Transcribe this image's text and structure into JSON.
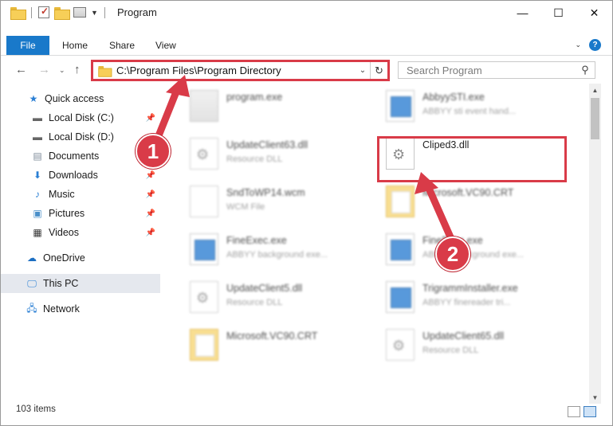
{
  "window": {
    "title": "Program",
    "controls": {
      "minimize": "—",
      "maximize": "☐",
      "close": "✕"
    }
  },
  "ribbon": {
    "file": "File",
    "tabs": [
      "Home",
      "Share",
      "View"
    ]
  },
  "address": {
    "path": "C:\\Program Files\\Program Directory",
    "search_placeholder": "Search Program"
  },
  "nav": {
    "quick_access": "Quick access",
    "items": [
      {
        "label": "Local Disk (C:)",
        "icon": "drive-icon",
        "pinned": true
      },
      {
        "label": "Local Disk (D:)",
        "icon": "drive-icon",
        "pinned": false
      },
      {
        "label": "Documents",
        "icon": "documents-icon",
        "pinned": true
      },
      {
        "label": "Downloads",
        "icon": "downloads-icon",
        "pinned": true
      },
      {
        "label": "Music",
        "icon": "music-icon",
        "pinned": true
      },
      {
        "label": "Pictures",
        "icon": "pictures-icon",
        "pinned": true
      },
      {
        "label": "Videos",
        "icon": "videos-icon",
        "pinned": true
      }
    ],
    "onedrive": "OneDrive",
    "thispc": "This PC",
    "network": "Network"
  },
  "files": [
    {
      "name": "program.exe",
      "sub": "",
      "kind": "app"
    },
    {
      "name": "AbbyySTI.exe",
      "sub": "ABBYY sti event hand...",
      "kind": "exe"
    },
    {
      "name": "UpdateClient63.dll",
      "sub": "Resource DLL",
      "kind": "dll"
    },
    {
      "name": "Cliped3.dll",
      "sub": "",
      "kind": "dll"
    },
    {
      "name": "SndToWP14.wcm",
      "sub": "WCM File",
      "kind": "doc"
    },
    {
      "name": "Microsoft.VC90.CRT",
      "sub": "",
      "kind": "folder"
    },
    {
      "name": "FineExec.exe",
      "sub": "ABBYY background exe...",
      "kind": "exe"
    },
    {
      "name": "FineExec.exe",
      "sub": "ABBYY background exe...",
      "kind": "exe"
    },
    {
      "name": "UpdateClient5.dll",
      "sub": "Resource DLL",
      "kind": "dll"
    },
    {
      "name": "TrigrammInstaller.exe",
      "sub": "ABBYY finereader tri...",
      "kind": "exe"
    },
    {
      "name": "Microsoft.VC90.CRT",
      "sub": "",
      "kind": "folder"
    },
    {
      "name": "UpdateClient65.dll",
      "sub": "Resource DLL",
      "kind": "dll"
    }
  ],
  "status": {
    "count": "103 items"
  },
  "callouts": [
    "1",
    "2"
  ],
  "colors": {
    "accent": "#1979ca",
    "highlight": "#d93b48"
  }
}
